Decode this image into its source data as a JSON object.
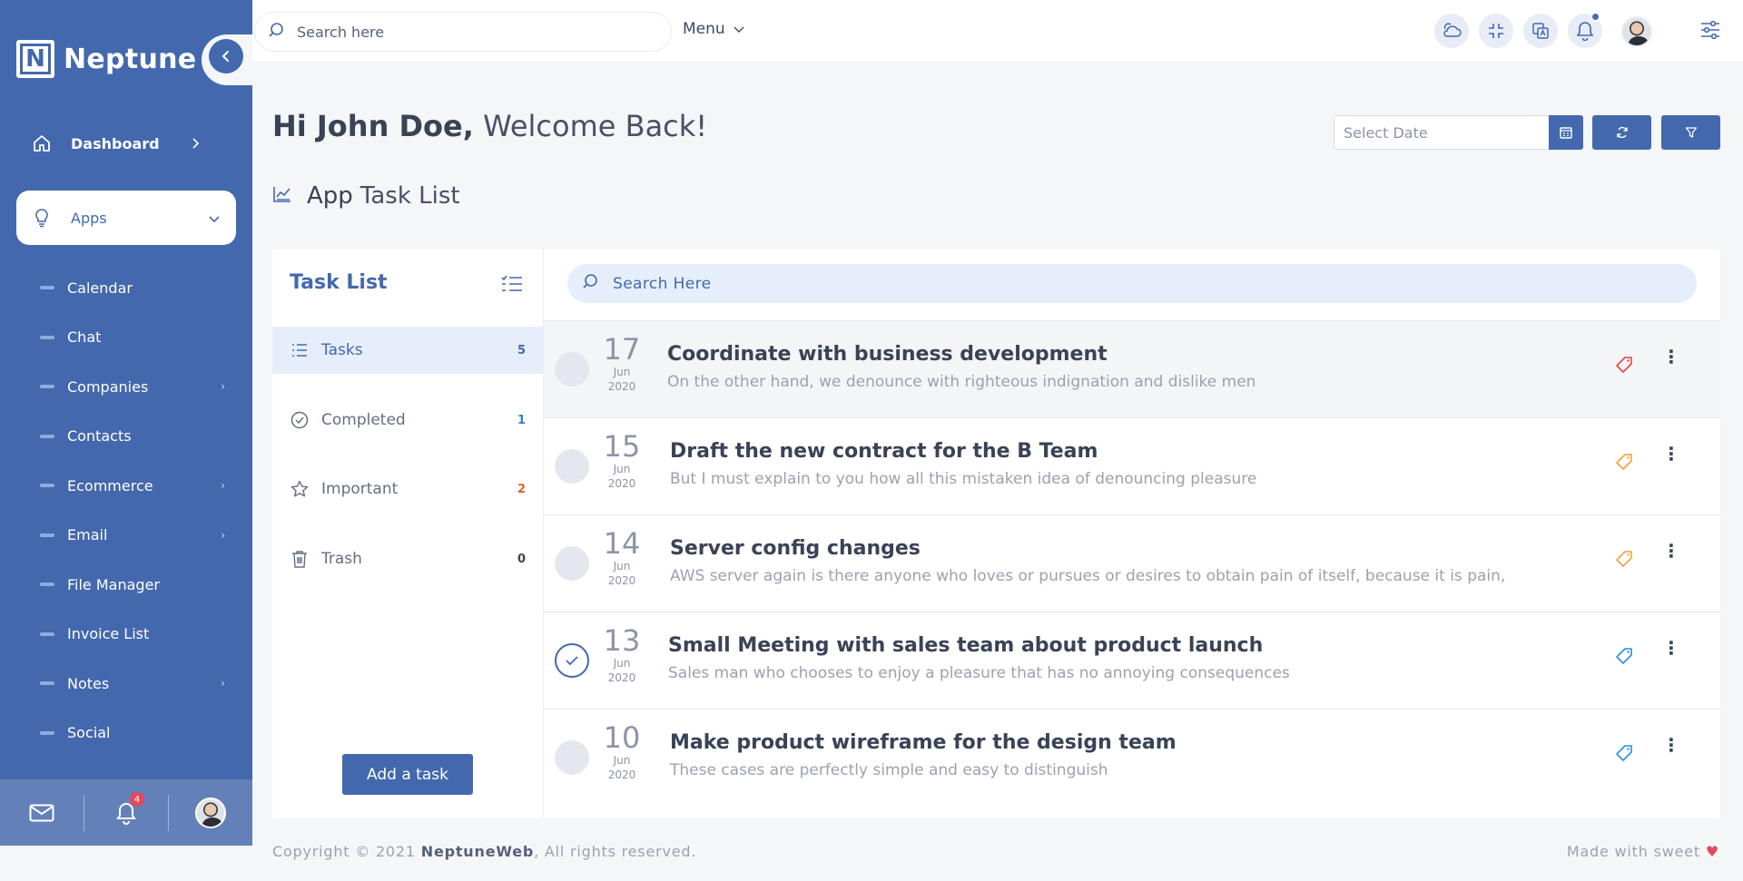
{
  "brand": {
    "logo_letter": "N",
    "name": "Neptune"
  },
  "sidebar": {
    "dashboard_label": "Dashboard",
    "apps_label": "Apps",
    "items": [
      {
        "label": "Calendar",
        "has_children": false
      },
      {
        "label": "Chat",
        "has_children": false
      },
      {
        "label": "Companies",
        "has_children": true
      },
      {
        "label": "Contacts",
        "has_children": false
      },
      {
        "label": "Ecommerce",
        "has_children": true
      },
      {
        "label": "Email",
        "has_children": true
      },
      {
        "label": "File Manager",
        "has_children": false
      },
      {
        "label": "Invoice List",
        "has_children": false
      },
      {
        "label": "Notes",
        "has_children": true
      },
      {
        "label": "Social",
        "has_children": false
      }
    ],
    "footer": {
      "notification_count": "4"
    }
  },
  "topbar": {
    "search_placeholder": "Search here",
    "menu_label": "Menu",
    "icons": [
      "weather-icon",
      "compress-icon",
      "translate-icon",
      "bell-icon"
    ]
  },
  "page": {
    "greeting_name": "Hi John Doe,",
    "greeting_rest": "Welcome Back!",
    "date_placeholder": "Select Date",
    "section_title_bold": "App",
    "section_title_light": "Task List"
  },
  "tasklist": {
    "title": "Task List",
    "folders": [
      {
        "label": "Tasks",
        "count": "5",
        "icon": "list-icon",
        "count_color": "#4368ad"
      },
      {
        "label": "Completed",
        "count": "1",
        "icon": "check-circle-icon",
        "count_color": "#2d7fd1"
      },
      {
        "label": "Important",
        "count": "2",
        "icon": "star-icon",
        "count_color": "#e0602e"
      },
      {
        "label": "Trash",
        "count": "0",
        "icon": "trash-icon",
        "count_color": "#3a4256"
      }
    ],
    "add_button": "Add a task",
    "search_placeholder": "Search Here",
    "tasks": [
      {
        "day": "17",
        "month": "Jun",
        "year": "2020",
        "title": "Coordinate with business development",
        "desc": "On the other hand, we denounce with righteous indignation and dislike men",
        "tag_color": "#e04545",
        "done": false
      },
      {
        "day": "15",
        "month": "Jun",
        "year": "2020",
        "title": "Draft the new contract for the B Team",
        "desc": "But I must explain to you how all this mistaken idea of denouncing pleasure",
        "tag_color": "#f0a33a",
        "done": false
      },
      {
        "day": "14",
        "month": "Jun",
        "year": "2020",
        "title": "Server config changes",
        "desc": "AWS server again is there anyone who loves or pursues or desires to obtain pain of itself, because it is pain,",
        "tag_color": "#f0a33a",
        "done": false
      },
      {
        "day": "13",
        "month": "Jun",
        "year": "2020",
        "title": "Small Meeting with sales team about product launch",
        "desc": "Sales man who chooses to enjoy a pleasure that has no annoying consequences",
        "tag_color": "#2d8fe0",
        "done": true
      },
      {
        "day": "10",
        "month": "Jun",
        "year": "2020",
        "title": "Make product wireframe for the design team",
        "desc": "These cases are perfectly simple and easy to distinguish",
        "tag_color": "#2d8fe0",
        "done": false
      }
    ]
  },
  "footer": {
    "copyright_prefix": "Copyright © 2021",
    "company": "NeptuneWeb",
    "copyright_suffix": ", All rights reserved.",
    "made_with": "Made with sweet",
    "heart": "♥"
  },
  "colors": {
    "primary": "#4368ad",
    "accent_light": "#e6eefb",
    "danger": "#e6485a"
  }
}
